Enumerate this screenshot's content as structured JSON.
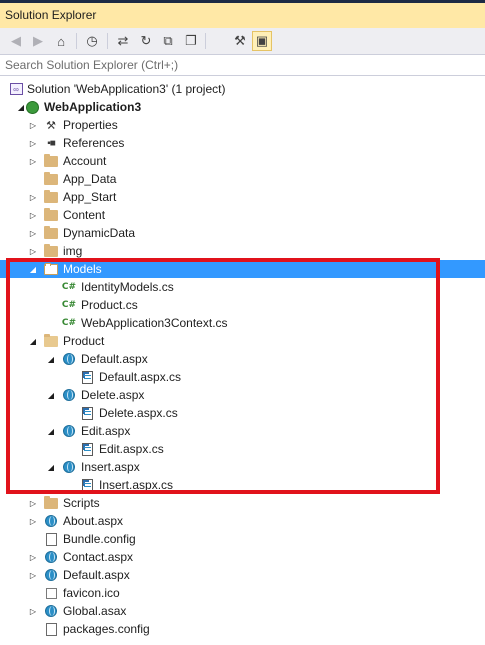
{
  "window": {
    "title": "Solution Explorer"
  },
  "search": {
    "placeholder": "Search Solution Explorer (Ctrl+;)"
  },
  "toolbar": {
    "buttons": [
      {
        "name": "back-button",
        "icon": "back-arrow-icon",
        "glyph": "◀"
      },
      {
        "name": "forward-button",
        "icon": "forward-arrow-icon",
        "glyph": "▶"
      },
      {
        "name": "home-button",
        "icon": "home-icon",
        "glyph": "⌂"
      },
      {
        "name": "pending-changes-filter-button",
        "icon": "clock-icon",
        "glyph": "◷"
      },
      {
        "name": "sync-with-active-document-button",
        "icon": "sync-arrows-icon",
        "glyph": "⇄"
      },
      {
        "name": "refresh-button",
        "icon": "refresh-icon",
        "glyph": "↻"
      },
      {
        "name": "collapse-all-button",
        "icon": "collapse-all-icon",
        "glyph": "⧉"
      },
      {
        "name": "show-all-files-button",
        "icon": "show-all-files-icon",
        "glyph": "❐"
      },
      {
        "name": "properties-button",
        "icon": "wrench-icon",
        "glyph": "⚒"
      },
      {
        "name": "preview-selected-items-button",
        "icon": "preview-icon",
        "glyph": "▣"
      }
    ]
  },
  "tree": {
    "items": [
      {
        "label": "Solution 'WebApplication3' (1 project)",
        "icon": "solution-icon",
        "expander": "",
        "level": 0
      },
      {
        "label": "WebApplication3",
        "icon": "project-icon",
        "expander": "◢",
        "level": 1
      },
      {
        "label": "Properties",
        "icon": "wrench-icon",
        "expander": "▷",
        "level": 2
      },
      {
        "label": "References",
        "icon": "references-icon",
        "expander": "▷",
        "level": 2
      },
      {
        "label": "Account",
        "icon": "folder-icon",
        "expander": "▷",
        "level": 2
      },
      {
        "label": "App_Data",
        "icon": "folder-icon",
        "expander": "",
        "level": 2
      },
      {
        "label": "App_Start",
        "icon": "folder-icon",
        "expander": "▷",
        "level": 2
      },
      {
        "label": "Content",
        "icon": "folder-icon",
        "expander": "▷",
        "level": 2
      },
      {
        "label": "DynamicData",
        "icon": "folder-icon",
        "expander": "▷",
        "level": 2
      },
      {
        "label": "img",
        "icon": "folder-icon",
        "expander": "▷",
        "level": 2
      },
      {
        "label": "Models",
        "icon": "folder-open-icon",
        "expander": "◢",
        "level": 2
      },
      {
        "label": "IdentityModels.cs",
        "icon": "csharp-file-icon",
        "expander": "",
        "level": 3
      },
      {
        "label": "Product.cs",
        "icon": "csharp-file-icon",
        "expander": "",
        "level": 3
      },
      {
        "label": "WebApplication3Context.cs",
        "icon": "csharp-file-icon",
        "expander": "",
        "level": 3
      },
      {
        "label": "Product",
        "icon": "folder-open-icon",
        "expander": "◢",
        "level": 2
      },
      {
        "label": "Default.aspx",
        "icon": "aspx-file-icon",
        "expander": "◢",
        "level": 3
      },
      {
        "label": "Default.aspx.cs",
        "icon": "code-behind-file-icon",
        "expander": "",
        "level": 4
      },
      {
        "label": "Delete.aspx",
        "icon": "aspx-file-icon",
        "expander": "◢",
        "level": 3
      },
      {
        "label": "Delete.aspx.cs",
        "icon": "code-behind-file-icon",
        "expander": "",
        "level": 4
      },
      {
        "label": "Edit.aspx",
        "icon": "aspx-file-icon",
        "expander": "◢",
        "level": 3
      },
      {
        "label": "Edit.aspx.cs",
        "icon": "code-behind-file-icon",
        "expander": "",
        "level": 4
      },
      {
        "label": "Insert.aspx",
        "icon": "aspx-file-icon",
        "expander": "◢",
        "level": 3
      },
      {
        "label": "Insert.aspx.cs",
        "icon": "code-behind-file-icon",
        "expander": "",
        "level": 4
      },
      {
        "label": "Scripts",
        "icon": "folder-icon",
        "expander": "▷",
        "level": 2
      },
      {
        "label": "About.aspx",
        "icon": "aspx-file-icon",
        "expander": "▷",
        "level": 2
      },
      {
        "label": "Bundle.config",
        "icon": "config-file-icon",
        "expander": "",
        "level": 2
      },
      {
        "label": "Contact.aspx",
        "icon": "aspx-file-icon",
        "expander": "▷",
        "level": 2
      },
      {
        "label": "Default.aspx",
        "icon": "aspx-file-icon",
        "expander": "▷",
        "level": 2
      },
      {
        "label": "favicon.ico",
        "icon": "image-file-icon",
        "expander": "",
        "level": 2
      },
      {
        "label": "Global.asax",
        "icon": "aspx-file-icon",
        "expander": "▷",
        "level": 2
      },
      {
        "label": "packages.config",
        "icon": "config-file-icon",
        "expander": "",
        "level": 2
      }
    ],
    "selected_label": "Models"
  },
  "annotation": {
    "color": "#e1121b"
  },
  "colors": {
    "selection": "#3399ff",
    "titlebar": "#ffe8a6",
    "toolbar": "#eeeef2",
    "folder": "#dcb67a",
    "csharp": "#368832"
  }
}
